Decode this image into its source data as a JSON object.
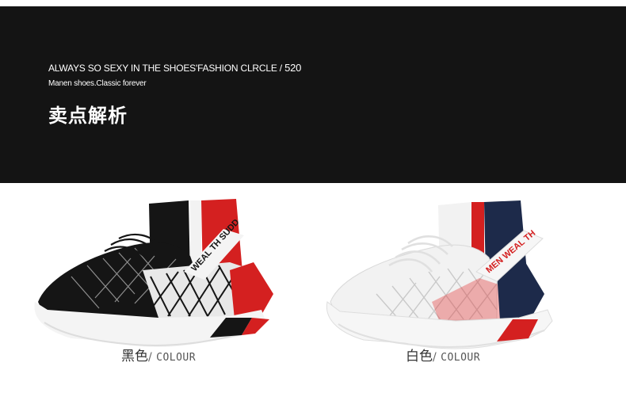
{
  "banner": {
    "tagline": "ALWAYS SO SEXY IN THE SHOES'FASHION CLRCLE /",
    "tagline_num": "520",
    "subline": "Manen shoes.Classic forever",
    "heading": "卖点解析"
  },
  "products": [
    {
      "color_cn": "黑色",
      "separator": "/",
      "color_en": "COLOUR",
      "strap_text": "WEAL TH SUDD",
      "upper_color": "#151515",
      "accent_color": "#d42020",
      "sole_color": "#f4f4f4"
    },
    {
      "color_cn": "白色",
      "separator": "/",
      "color_en": "COLOUR",
      "strap_text": "MEN WEAL TH",
      "upper_color": "#f2f2f2",
      "accent_color": "#d42020",
      "collar_stripe_color": "#1d2a4a",
      "sole_color": "#f6f6f6"
    }
  ]
}
